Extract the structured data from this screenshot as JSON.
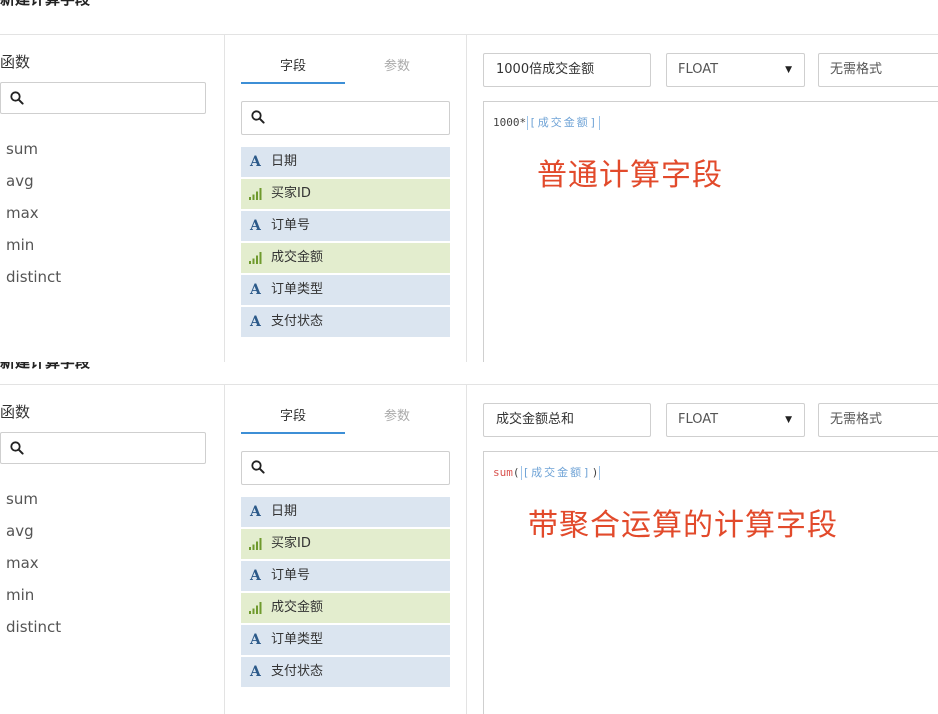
{
  "panels": [
    {
      "title": "新建计算字段",
      "functions": {
        "title": "函数",
        "items": [
          "sum",
          "avg",
          "max",
          "min",
          "distinct"
        ]
      },
      "fields": {
        "tabs": [
          "字段",
          "参数"
        ],
        "active_tab": "字段",
        "items": [
          {
            "label": "日期",
            "kind": "dimension",
            "icon": "text-A-icon"
          },
          {
            "label": "买家ID",
            "kind": "measure",
            "icon": "bar-signal-icon"
          },
          {
            "label": "订单号",
            "kind": "dimension",
            "icon": "text-A-icon"
          },
          {
            "label": "成交金额",
            "kind": "measure",
            "icon": "bar-signal-icon"
          },
          {
            "label": "订单类型",
            "kind": "dimension",
            "icon": "text-A-icon"
          },
          {
            "label": "支付状态",
            "kind": "dimension",
            "icon": "text-A-icon"
          }
        ]
      },
      "editor": {
        "name_value": "1000倍成交金额",
        "type_value": "FLOAT",
        "format_value": "无需格式",
        "formula": {
          "prefix": "1000*",
          "fn": "",
          "open": "",
          "ref": "[成交金额]",
          "close": ""
        },
        "annotation": "普通计算字段"
      }
    },
    {
      "title": "新建计算字段",
      "functions": {
        "title": "函数",
        "items": [
          "sum",
          "avg",
          "max",
          "min",
          "distinct"
        ]
      },
      "fields": {
        "tabs": [
          "字段",
          "参数"
        ],
        "active_tab": "字段",
        "items": [
          {
            "label": "日期",
            "kind": "dimension",
            "icon": "text-A-icon"
          },
          {
            "label": "买家ID",
            "kind": "measure",
            "icon": "bar-signal-icon"
          },
          {
            "label": "订单号",
            "kind": "dimension",
            "icon": "text-A-icon"
          },
          {
            "label": "成交金额",
            "kind": "measure",
            "icon": "bar-signal-icon"
          },
          {
            "label": "订单类型",
            "kind": "dimension",
            "icon": "text-A-icon"
          },
          {
            "label": "支付状态",
            "kind": "dimension",
            "icon": "text-A-icon"
          }
        ]
      },
      "editor": {
        "name_value": "成交金额总和",
        "type_value": "FLOAT",
        "format_value": "无需格式",
        "formula": {
          "prefix": "",
          "fn": "sum",
          "open": "(",
          "ref": "[成交金额]",
          "close": ")"
        },
        "annotation": "带聚合运算的计算字段"
      }
    }
  ],
  "colors": {
    "dimension_bg": "#dbe5f0",
    "measure_bg": "#e3edce",
    "annotation": "#e24a2b",
    "tab_active_underline": "#3d8fd6",
    "field_ref": "#6fa3d6",
    "function_name": "#d9534f"
  }
}
